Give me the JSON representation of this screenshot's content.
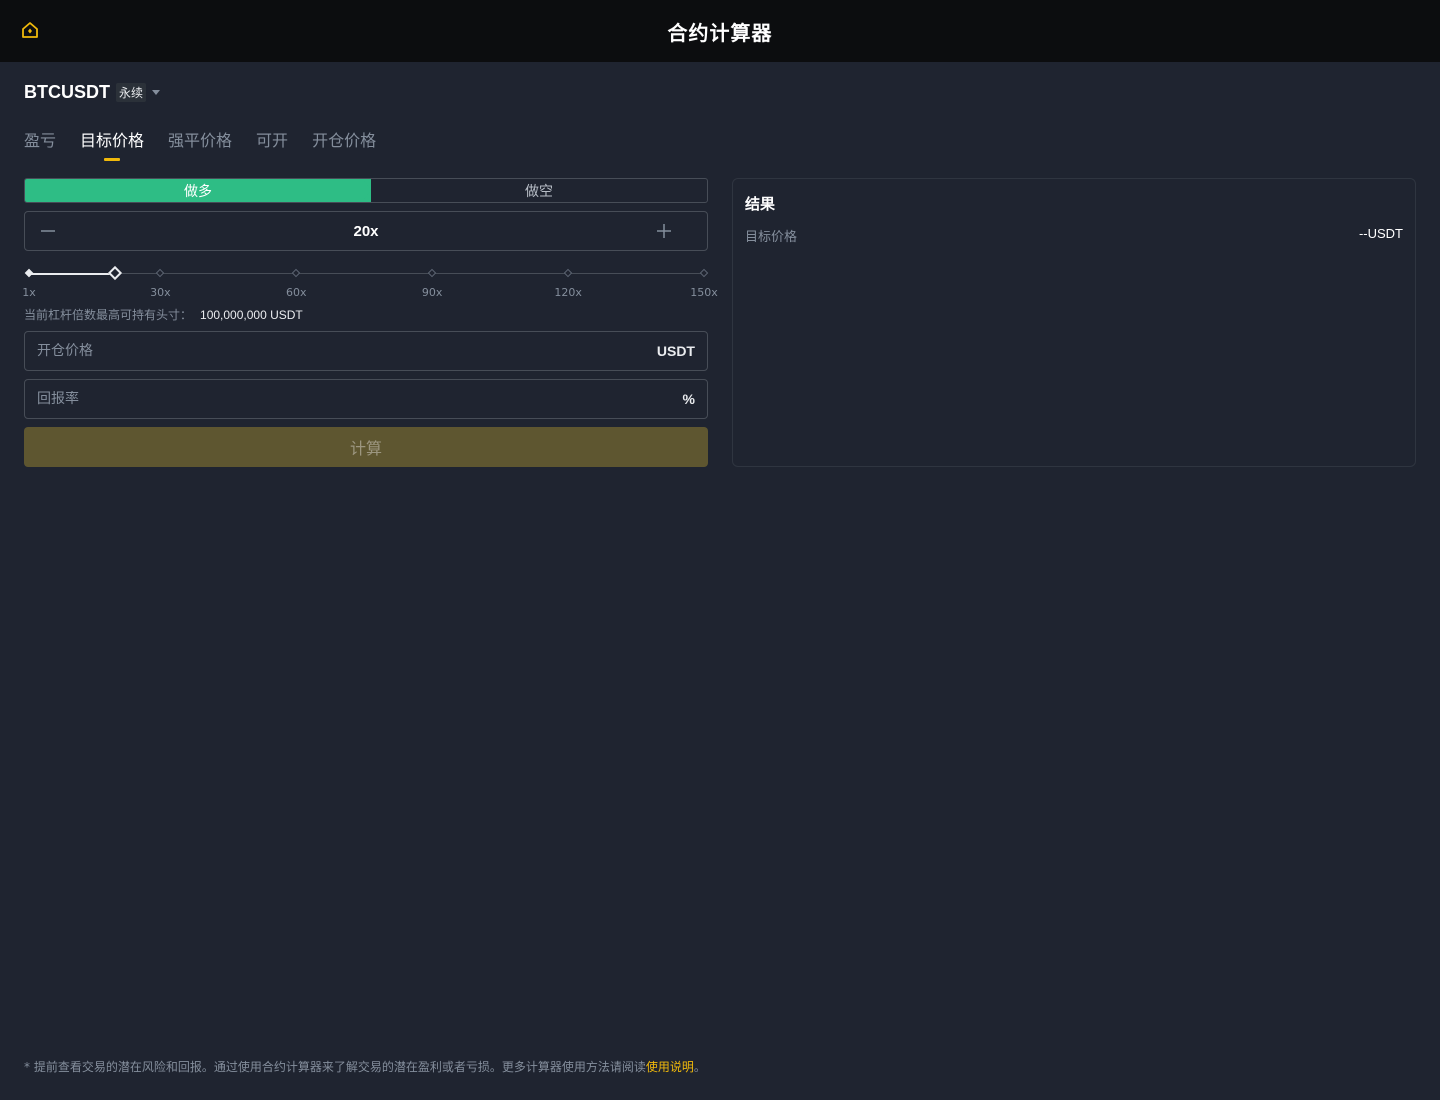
{
  "header": {
    "title": "合约计算器",
    "home_icon": "home-icon"
  },
  "symbol": {
    "name": "BTCUSDT",
    "badge": "永续"
  },
  "tabs": [
    {
      "label": "盈亏",
      "active": false
    },
    {
      "label": "目标价格",
      "active": true
    },
    {
      "label": "强平价格",
      "active": false
    },
    {
      "label": "可开",
      "active": false
    },
    {
      "label": "开仓价格",
      "active": false
    }
  ],
  "side": {
    "long_label": "做多",
    "short_label": "做空",
    "selected": "long"
  },
  "leverage": {
    "value_label": "20x",
    "value": 20,
    "min": 1,
    "max": 150,
    "ticks": [
      "1x",
      "30x",
      "60x",
      "90x",
      "120x",
      "150x"
    ]
  },
  "max_position": {
    "label": "当前杠杆倍数最高可持有头寸：",
    "value": "100,000,000 USDT"
  },
  "entry_price": {
    "placeholder": "开仓价格",
    "unit": "USDT"
  },
  "roe": {
    "placeholder": "回报率",
    "unit": "%"
  },
  "calculate": {
    "label": "计算"
  },
  "result": {
    "title": "结果",
    "rows": [
      {
        "label": "目标价格",
        "value": "--USDT"
      }
    ]
  },
  "footer": {
    "text": "* 提前查看交易的潜在风险和回报。通过使用合约计算器来了解交易的潜在盈利或者亏损。更多计算器使用方法请阅读",
    "link": "使用说明",
    "suffix": "。"
  },
  "colors": {
    "accent": "#f0b90b",
    "long": "#2ebd85",
    "background": "#1f2430",
    "header": "#0c0d0f"
  }
}
